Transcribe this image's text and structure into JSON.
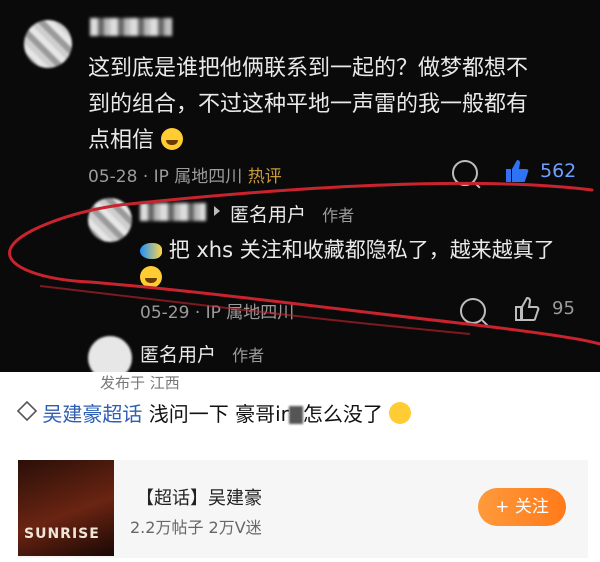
{
  "comment1": {
    "text_line1": "这到底是谁把他俩联系到一起的？做梦都想不",
    "text_line2": "到的组合，不过这种平地一声雷的我一般都有",
    "text_line3": "点相信",
    "date": "05-28",
    "location": "IP 属地四川",
    "hot_badge": "热评",
    "like_count": "562"
  },
  "reply": {
    "username": "匿名用户",
    "author_tag": "作者",
    "text_line1": "把 xhs 关注和收藏都隐私了，越来越真了",
    "date": "05-29",
    "location": "IP 属地四川",
    "like_count": "95"
  },
  "reply2": {
    "username": "匿名用户",
    "author_tag": "作者"
  },
  "post": {
    "location": "发布于 江西",
    "topic_tag": "吴建豪超话",
    "text_a": "浅问一下 豪哥ir",
    "text_b": "怎么没了"
  },
  "supertopic_card": {
    "title": "【超话】吴建豪",
    "stats": "2.2万帖子 2万V迷",
    "cover_text": "SUNRISE",
    "follow_label": "+ 关注"
  },
  "colors": {
    "accent_blue": "#2f73f4",
    "hot_gold": "#c79a3c",
    "follow_orange": "#ff8a2a",
    "annotation_red": "#c9232e"
  }
}
